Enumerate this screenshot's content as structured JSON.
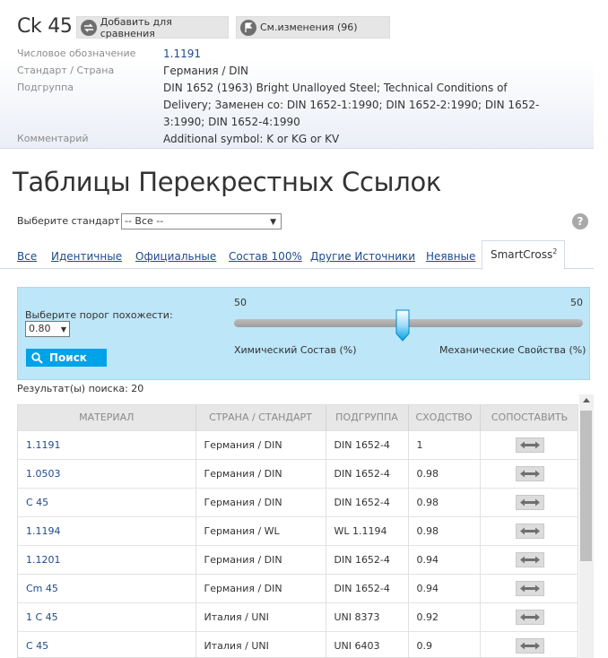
{
  "material": {
    "title": "Ck 45",
    "add_compare_label": "Добавить для сравнения",
    "changes_label": "См.изменения (96)"
  },
  "info": [
    {
      "label": "Числовое обозначение",
      "value": "1.1191"
    },
    {
      "label": "Стандарт / Страна",
      "value": "Германия / DIN"
    },
    {
      "label": "Подгруппа",
      "value": "DIN 1652 (1963) Bright Unalloyed Steel; Technical Conditions of Delivery; Заменен со: DIN 1652-1:1990; DIN 1652-2:1990; DIN 1652-3:1990; DIN 1652-4:1990"
    },
    {
      "label": "Комментарий",
      "value": "Additional symbol: K or KG or KV"
    }
  ],
  "section_title": "Таблицы Перекрестных Ссылок",
  "standard_filter": {
    "label": "Выберите стандарт:",
    "selected": "-- Все --"
  },
  "tabs": [
    {
      "label": "Все"
    },
    {
      "label": "Идентичные"
    },
    {
      "label": "Официальные"
    },
    {
      "label": "Состав 100%"
    },
    {
      "label": "Другие Источники"
    },
    {
      "label": "Неявные"
    },
    {
      "label": "SmartCross",
      "sup": "2",
      "active": true
    }
  ],
  "smartcross": {
    "threshold_label": "Выберите порог похожести:",
    "threshold_value": "0.80",
    "search_label": "Поиск",
    "slider_left_value": "50",
    "slider_right_value": "50",
    "slider_position": 0.5,
    "left_caption": "Химический Состав (%)",
    "right_caption": "Механические Свойства (%)"
  },
  "results_label": "Результат(ы) поиска: 20",
  "table": {
    "columns": [
      "МАТЕРИАЛ",
      "СТРАНА / СТАНДАРТ",
      "ПОДГРУППА",
      "СХОДСТВО",
      "СОПОСТАВИТЬ"
    ],
    "rows": [
      {
        "material": "1.1191",
        "country": "Германия / DIN",
        "subgroup": "DIN 1652-4",
        "similarity": "1"
      },
      {
        "material": "1.0503",
        "country": "Германия / DIN",
        "subgroup": "DIN 1652-4",
        "similarity": "0.98"
      },
      {
        "material": "C 45",
        "country": "Германия / DIN",
        "subgroup": "DIN 1652-4",
        "similarity": "0.98"
      },
      {
        "material": "1.1194",
        "country": "Германия / WL",
        "subgroup": "WL 1.1194",
        "similarity": "0.98"
      },
      {
        "material": "1.1201",
        "country": "Германия / DIN",
        "subgroup": "DIN 1652-4",
        "similarity": "0.94"
      },
      {
        "material": "Cm 45",
        "country": "Германия / DIN",
        "subgroup": "DIN 1652-4",
        "similarity": "0.94"
      },
      {
        "material": "1 C 45",
        "country": "Италия / UNI",
        "subgroup": "UNI 8373",
        "similarity": "0.92"
      },
      {
        "material": "C 45",
        "country": "Италия / UNI",
        "subgroup": "UNI 6403",
        "similarity": "0.9"
      }
    ]
  },
  "colors": {
    "link": "#1e4a8c",
    "accent": "#00a2e8",
    "panel": "#bde6f8"
  }
}
